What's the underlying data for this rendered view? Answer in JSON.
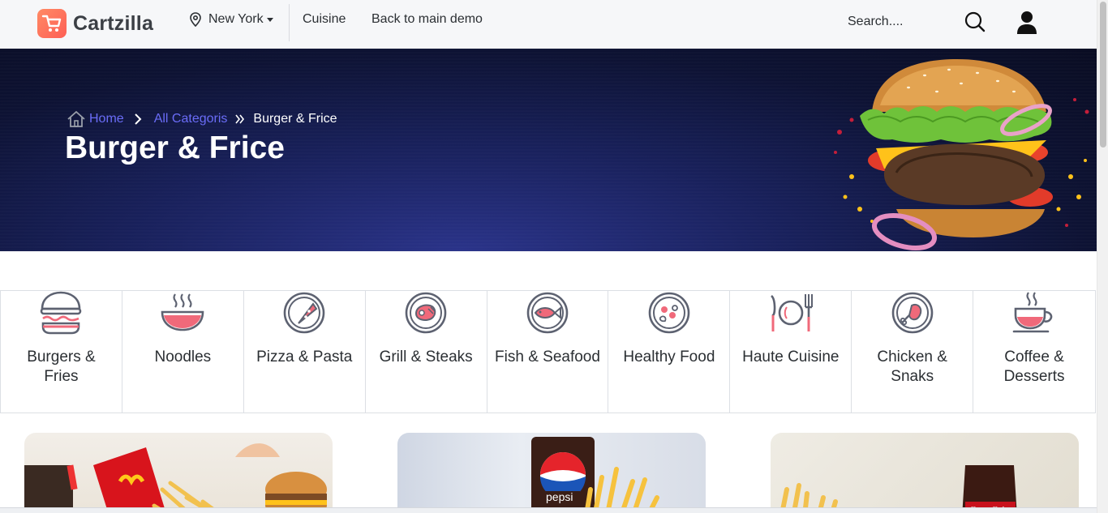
{
  "header": {
    "logo_text": "Cartzilla",
    "location": "New York",
    "nav": [
      "Cuisine",
      "Back to main demo"
    ],
    "search_placeholder": "Search....",
    "accent_color": "#fe5f55"
  },
  "hero": {
    "breadcrumb": {
      "home": "Home",
      "category": "All Categoris",
      "current": "Burger & Frice"
    },
    "title": "Burger & Frice",
    "link_color": "#6a6cf7"
  },
  "categories": [
    {
      "label": "Burgers & Fries",
      "icon": "burger-icon"
    },
    {
      "label": "Noodles",
      "icon": "noodle-bowl-icon"
    },
    {
      "label": "Pizza & Pasta",
      "icon": "pizza-icon"
    },
    {
      "label": "Grill & Steaks",
      "icon": "steak-icon"
    },
    {
      "label": "Fish & Seafood",
      "icon": "fish-icon"
    },
    {
      "label": "Healthy Food",
      "icon": "salad-icon"
    },
    {
      "label": "Haute Cuisine",
      "icon": "cutlery-icon"
    },
    {
      "label": "Chicken & Snaks",
      "icon": "chicken-leg-icon"
    },
    {
      "label": "Coffee & Desserts",
      "icon": "coffee-cup-icon"
    }
  ]
}
